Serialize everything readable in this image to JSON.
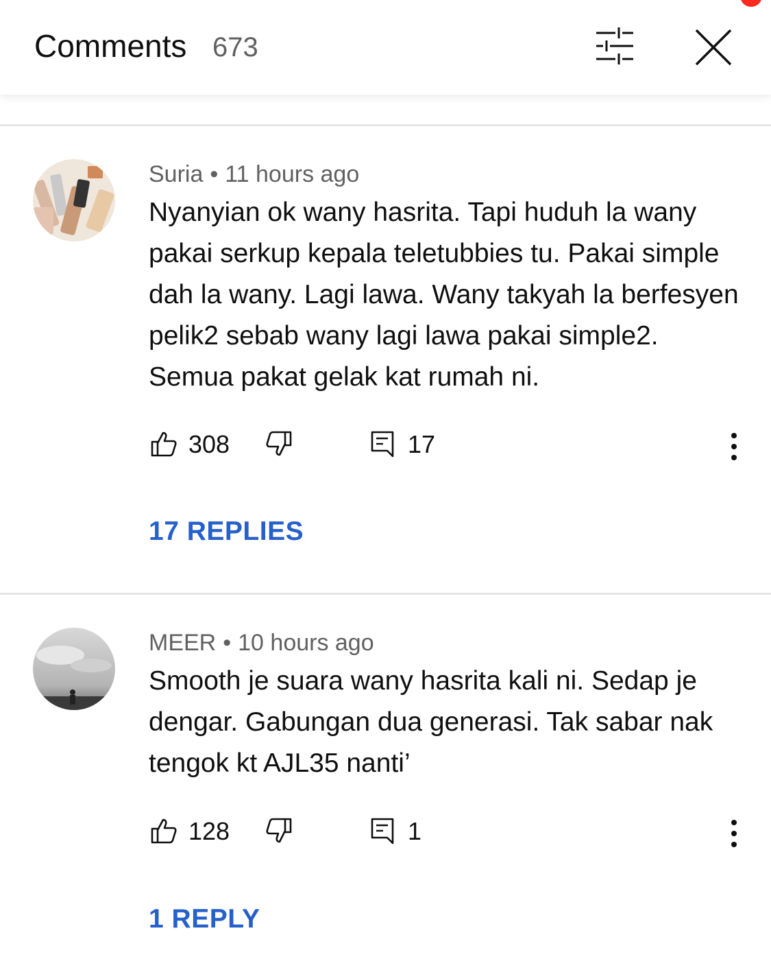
{
  "header": {
    "title": "Comments",
    "count": "673",
    "filter_icon": "sliders-icon",
    "close_icon": "close-icon"
  },
  "comments": [
    {
      "author": "Suria",
      "separator": "•",
      "time": "11 hours ago",
      "text": "Nyanyian ok wany hasrita. Tapi huduh la wany pakai serkup kepala teletubbies tu. Pakai simple dah la wany. Lagi lawa. Wany takyah la berfesyen pelik2 sebab wany lagi lawa pakai simple2. Semua pakat gelak kat rumah ni.",
      "likes": "308",
      "reply_count": "17",
      "replies_label": "17 REPLIES"
    },
    {
      "author": "MEER",
      "separator": "•",
      "time": "10 hours ago",
      "text": "Smooth je suara wany hasrita kali ni. Sedap je dengar. Gabungan dua generasi. Tak sabar nak tengok kt AJL35 nanti’",
      "likes": "128",
      "reply_count": "1",
      "replies_label": "1 REPLY"
    }
  ],
  "colors": {
    "link": "#2660c9",
    "secondary_text": "#606060",
    "notification_dot": "#ff2a1f"
  }
}
